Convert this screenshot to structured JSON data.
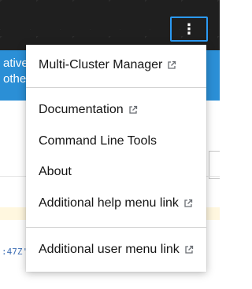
{
  "masthead": {
    "kebab_glyph": "⋮"
  },
  "background": {
    "banner_line1": "ative u",
    "banner_line2": "others",
    "mono_fragment": ":47Z'"
  },
  "menu": {
    "items": [
      {
        "label": "Multi-Cluster Manager",
        "icon": "external-link-icon"
      },
      {
        "label": "Documentation",
        "icon": "external-link-icon"
      },
      {
        "label": "Command Line Tools",
        "icon": ""
      },
      {
        "label": "About",
        "icon": ""
      },
      {
        "label": "Additional help menu link",
        "icon": "external-link-icon"
      },
      {
        "label": "Additional user menu link",
        "icon": "external-link-icon"
      }
    ]
  },
  "colors": {
    "masthead_bg": "#1f1f1f",
    "focus_blue": "#2b9af3",
    "banner_blue": "#2b8fd6",
    "warning_strip": "#fff7df",
    "menu_text": "#151515"
  }
}
